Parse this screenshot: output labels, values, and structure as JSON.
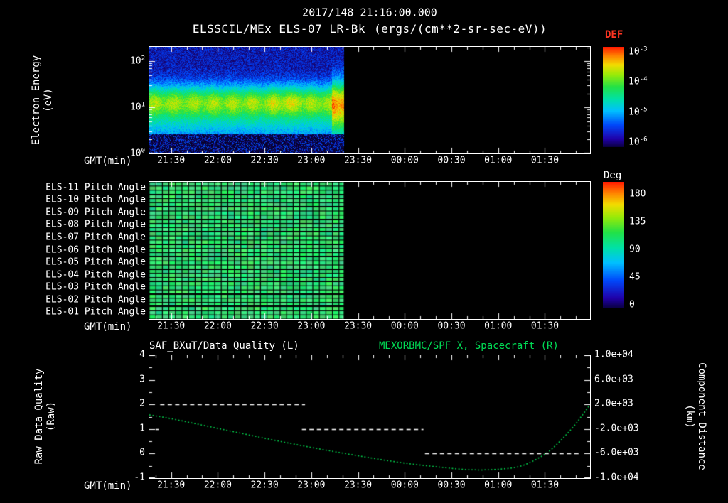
{
  "header": {
    "datetime": "2017/148 21:16:00.000",
    "instrument_title": "ELSSCIL/MEx ELS-07 LR-Bk",
    "units": "(ergs/(cm**2-sr-sec-eV))"
  },
  "time_axis": {
    "title": "GMT(min)",
    "start": "21:16",
    "total_minutes": 283,
    "minor_tick_minutes": 10,
    "ticks": [
      {
        "t": 14,
        "label": "21:30"
      },
      {
        "t": 44,
        "label": "22:00"
      },
      {
        "t": 74,
        "label": "22:30"
      },
      {
        "t": 104,
        "label": "23:00"
      },
      {
        "t": 134,
        "label": "23:30"
      },
      {
        "t": 164,
        "label": "00:00"
      },
      {
        "t": 194,
        "label": "00:30"
      },
      {
        "t": 224,
        "label": "01:00"
      },
      {
        "t": 254,
        "label": "01:30"
      }
    ]
  },
  "chart_data": [
    {
      "type": "heatmap",
      "name": "electron-energy-spectrogram",
      "ylabel_lines": [
        "Electron Energy",
        "(eV)"
      ],
      "y_scale": "log",
      "y_tick_exponents": [
        2,
        1,
        0
      ],
      "y_log_top": 2.31,
      "axis_minutes": [
        0,
        283
      ],
      "data_minutes": [
        0,
        125
      ],
      "features": {
        "main_band_center_eV": 13,
        "main_band_flux": "~1e-4 (green)",
        "low_band_center_eV": 4,
        "low_band_flux": "~3e-5 (cyan)",
        "high_energy_background": "~1e-6 (dark blue, speckled)",
        "bright_flux_enhancement_minutes": [
          117,
          125
        ]
      },
      "colorbar": {
        "title": "DEF",
        "title_color": "#ff3522",
        "tick_exponents": [
          -3,
          -4,
          -5,
          -6
        ],
        "scheme": "rainbow"
      }
    },
    {
      "type": "heatmap",
      "name": "pitch-angle-panels",
      "rows": [
        "ELS-11 Pitch Angle",
        "ELS-10 Pitch Angle",
        "ELS-09 Pitch Angle",
        "ELS-08 Pitch Angle",
        "ELS-07 Pitch Angle",
        "ELS-06 Pitch Angle",
        "ELS-05 Pitch Angle",
        "ELS-04 Pitch Angle",
        "ELS-03 Pitch Angle",
        "ELS-02 Pitch Angle",
        "ELS-01 Pitch Angle"
      ],
      "axis_minutes": [
        0,
        283
      ],
      "data_minutes": [
        0,
        125
      ],
      "typical_pitch_deg": 95,
      "colorbar": {
        "title": "Deg",
        "title_color": "#ffffff",
        "ticks": [
          180,
          135,
          90,
          45,
          0
        ],
        "range": [
          0,
          180
        ],
        "scheme": "rainbow"
      }
    },
    {
      "type": "line",
      "name": "quality-and-spacecraft-distance",
      "title_left": "SAF_BXuT/Data Quality (L)",
      "title_left_color": "#ffffff",
      "title_right": "MEXORBMC/SPF X, Spacecraft (R)",
      "title_right_color": "#00dd55",
      "left_axis": {
        "label_lines": [
          "Raw Data Quality",
          "(Raw)"
        ],
        "range": [
          -1,
          4
        ],
        "ticks": [
          4,
          3,
          2,
          1,
          0,
          -1
        ]
      },
      "right_axis": {
        "label_lines": [
          "Component Distance",
          "(km)"
        ],
        "range": [
          -10000,
          10000
        ],
        "tick_labels": [
          "1.0e+04",
          "6.0e+03",
          "2.0e+03",
          "-2.0e+03",
          "-6.0e+03",
          "-1.0e+04"
        ]
      },
      "series": [
        {
          "name": "Data Quality",
          "axis": "left",
          "style": "dashed",
          "color": "#ffffff",
          "segments": [
            {
              "t": [
                4,
                6
              ],
              "value": 1
            },
            {
              "t": [
                7,
                100
              ],
              "value": 2
            },
            {
              "t": [
                98,
                176
              ],
              "value": 1
            },
            {
              "t": [
                177,
                277
              ],
              "value": 0
            }
          ]
        },
        {
          "name": "Spacecraft X Distance",
          "axis": "right",
          "style": "dotted",
          "color": "#00d84e",
          "t_min": [
            0,
            14,
            44,
            74,
            104,
            134,
            164,
            194,
            209,
            224,
            239,
            254,
            264,
            274,
            283
          ],
          "km": [
            300,
            -320,
            -1900,
            -3500,
            -5000,
            -6350,
            -7550,
            -8400,
            -8650,
            -8550,
            -8000,
            -6100,
            -3900,
            -1100,
            2000
          ]
        }
      ]
    }
  ]
}
